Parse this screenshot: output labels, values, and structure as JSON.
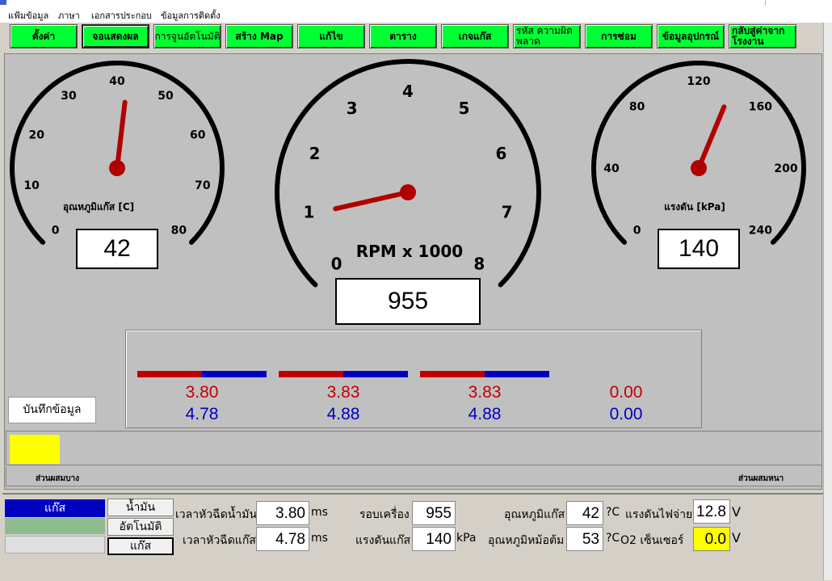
{
  "menu": [
    "แฟ้มข้อมูล",
    "ภาษา",
    "เอกสารประกอบ",
    "ข้อมูลการติดตั้ง"
  ],
  "nav": [
    {
      "label": "ตั้งค่า"
    },
    {
      "label": "จอแสดงผล"
    },
    {
      "label": "การจูนอัตโนมัติ"
    },
    {
      "label": "สร้าง Map"
    },
    {
      "label": "แก้ไข"
    },
    {
      "label": "ตาราง"
    },
    {
      "label": "เกจแก๊ส"
    },
    {
      "label": "รหัส ความผิดพลาด"
    },
    {
      "label": "การซ่อม"
    },
    {
      "label": "ข้อมูลอุปกรณ์"
    },
    {
      "label": "กลับสู่ค่าจากโรงงาน"
    }
  ],
  "gauges": {
    "temp": {
      "label": "อุณหภูมิแก๊ส [C]",
      "ticks": [
        "0",
        "10",
        "20",
        "30",
        "40",
        "50",
        "60",
        "70",
        "80"
      ],
      "value": "42",
      "needle_value": 42,
      "min": 0,
      "max": 80
    },
    "rpm": {
      "label": "RPM x 1000",
      "ticks": [
        "0",
        "1",
        "2",
        "3",
        "4",
        "5",
        "6",
        "7",
        "8"
      ],
      "value": "955",
      "needle_value": 0.955,
      "min": 0,
      "max": 8
    },
    "pressure": {
      "label": "แรงดัน [kPa]",
      "ticks": [
        "0",
        "40",
        "80",
        "120",
        "160",
        "200",
        "240"
      ],
      "value": "140",
      "needle_value": 140,
      "min": 0,
      "max": 240
    }
  },
  "injectors": {
    "petrol_color": "#c00000",
    "gas_color": "#0000c0",
    "items": [
      {
        "petrol": "3.80",
        "gas": "4.78"
      },
      {
        "petrol": "3.83",
        "gas": "4.88"
      },
      {
        "petrol": "3.83",
        "gas": "4.88"
      },
      {
        "petrol": "0.00",
        "gas": "0.00"
      }
    ]
  },
  "save_button": "บันทึกข้อมูล",
  "mixture": {
    "lean_label": "ส่วนผสมบาง",
    "rich_label": "ส่วนผสมหนา",
    "indicator_color": "#ffff00"
  },
  "fuel_status": {
    "gas": "แก๊ส",
    "petrol_btn": "น้ำมัน",
    "auto_btn": "อัตโนมัติ",
    "gas_btn": "แก๊ส"
  },
  "readouts": {
    "petrol_inj_label": "เวลาหัวฉีดน้ำมัน",
    "petrol_inj_value": "3.80",
    "petrol_inj_unit": "ms",
    "gas_inj_label": "เวลาหัวฉีดแก๊ส",
    "gas_inj_value": "4.78",
    "gas_inj_unit": "ms",
    "rpm_label": "รอบเครื่อง",
    "rpm_value": "955",
    "gas_press_label": "แรงดันแก๊ส",
    "gas_press_value": "140",
    "gas_press_unit": "kPa",
    "gas_temp_label": "อุณหภูมิแก๊ส",
    "gas_temp_value": "42",
    "gas_temp_unit": "?C",
    "red_temp_label": "อุณหภูมิหม้อต้ม",
    "red_temp_value": "53",
    "red_temp_unit": "?C",
    "voltage_label": "แรงดันไฟจ่าย",
    "voltage_value": "12.8",
    "voltage_unit": "V",
    "o2_label": "O2 เซ็นเซอร์",
    "o2_value": "0.0",
    "o2_unit": "V"
  }
}
